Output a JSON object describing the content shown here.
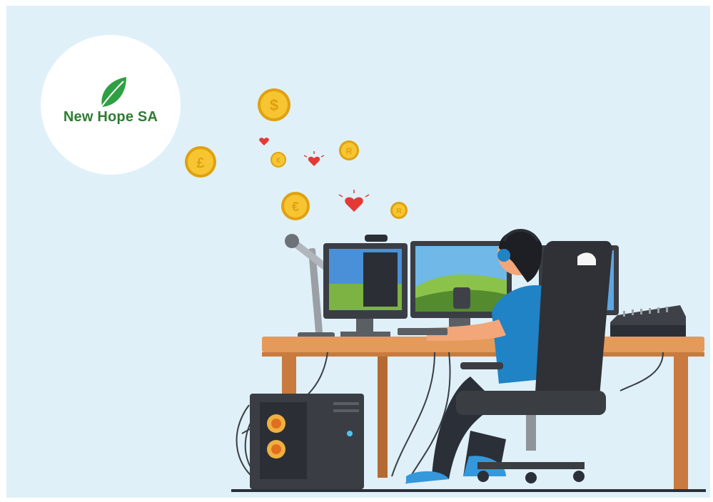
{
  "logo": {
    "name": "New Hope SA",
    "icon": "leaf-icon"
  },
  "illustration": {
    "subject": "person at gaming desk with monitors, microphone arm and PC tower",
    "floating_items": {
      "coins": [
        {
          "symbol": "$"
        },
        {
          "symbol": "£"
        },
        {
          "symbol": "€"
        },
        {
          "symbol": "R"
        },
        {
          "symbol": "€"
        },
        {
          "symbol": "R"
        }
      ],
      "hearts": 3
    }
  },
  "colors": {
    "background": "#dff0f8",
    "logo_green": "#2e7d32",
    "coin_gold": "#f2b81c",
    "heart_red": "#e53935",
    "desk_wood": "#d9864a",
    "chair": "#2f3136",
    "shirt": "#1f83c6"
  }
}
